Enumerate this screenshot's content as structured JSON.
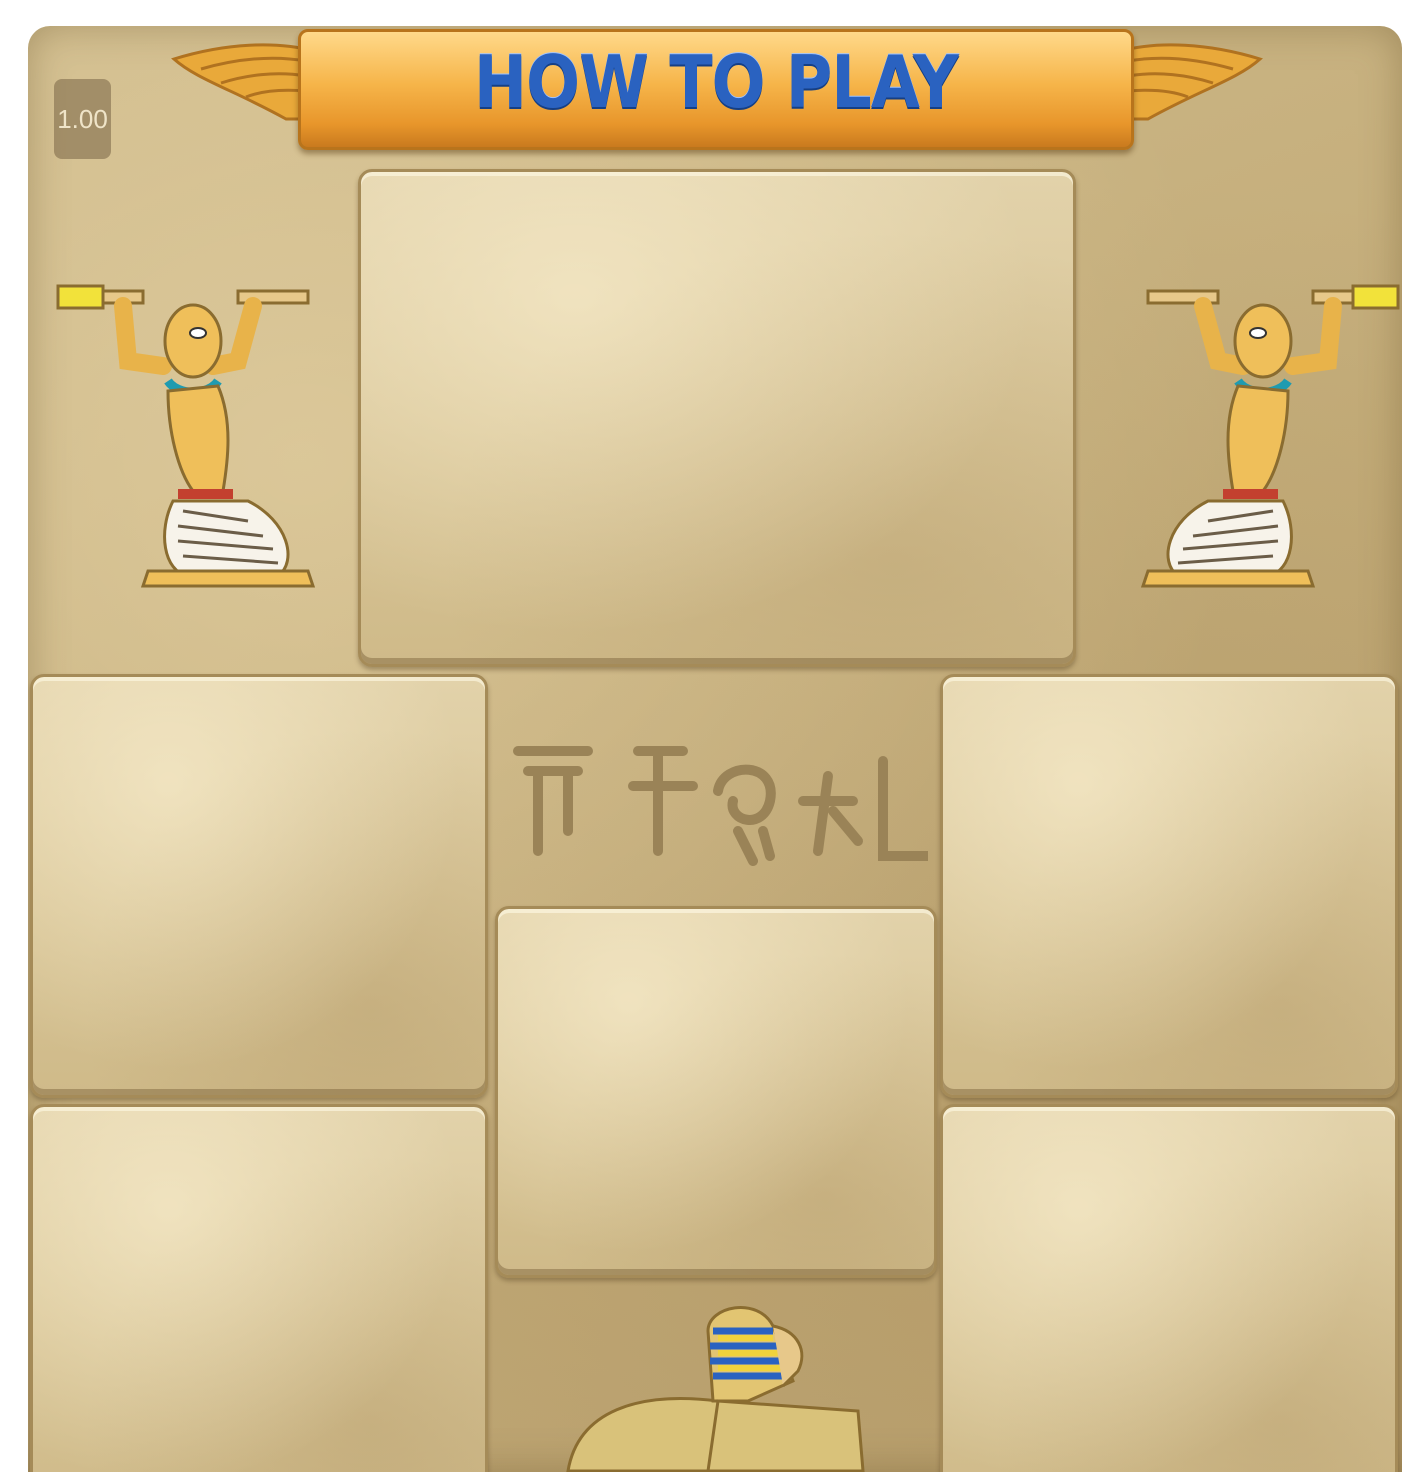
{
  "header": {
    "title": "HOW TO PLAY",
    "speed_label": "1.00"
  },
  "icons": {
    "left_figure": "kneeling-egyptian-figure-icon",
    "right_figure": "kneeling-egyptian-figure-icon",
    "bottom_figure": "sphinx-icon",
    "glyph_row": "hieroglyph-row-icon",
    "wings": "winged-emblem-icon"
  },
  "colors": {
    "stone": "#d8c597",
    "banner": "#f6b54a",
    "title": "#2a62c0"
  }
}
